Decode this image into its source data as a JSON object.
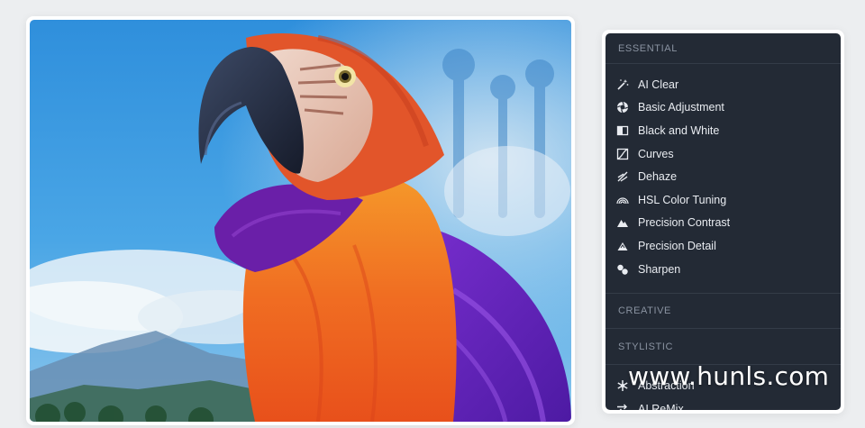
{
  "panel": {
    "sections": {
      "essential": "ESSENTIAL",
      "creative": "CREATIVE",
      "stylistic": "STYLISTIC"
    },
    "essential_items": [
      {
        "label": "AI Clear",
        "icon": "magic-wand-icon"
      },
      {
        "label": "Basic Adjustment",
        "icon": "aperture-icon"
      },
      {
        "label": "Black and White",
        "icon": "half-square-icon"
      },
      {
        "label": "Curves",
        "icon": "curve-icon"
      },
      {
        "label": "Dehaze",
        "icon": "dehaze-icon"
      },
      {
        "label": "HSL Color Tuning",
        "icon": "rainbow-icon"
      },
      {
        "label": "Precision Contrast",
        "icon": "mountain-icon"
      },
      {
        "label": "Precision Detail",
        "icon": "detail-mountain-icon"
      },
      {
        "label": "Sharpen",
        "icon": "droplets-icon"
      }
    ],
    "stylistic_items": [
      {
        "label": "Abstraction",
        "icon": "snowflake-icon"
      },
      {
        "label": "AI ReMix",
        "icon": "shuffle-icon"
      }
    ]
  },
  "watermark": "www.hunls.com"
}
